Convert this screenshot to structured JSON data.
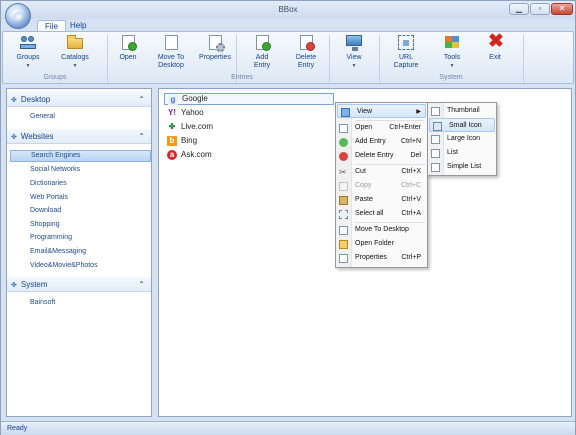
{
  "window": {
    "title": "BBox"
  },
  "tabs": [
    "File",
    "Help"
  ],
  "ribbon": {
    "groups_group": {
      "label": "Groups",
      "buttons": [
        {
          "label": "Groups"
        },
        {
          "label": "Catalogs"
        }
      ]
    },
    "entries_group": {
      "label": "Entries",
      "buttons": [
        {
          "label": "Open"
        },
        {
          "label": "Move To",
          "label2": "Desktop"
        },
        {
          "label": "Properties"
        },
        {
          "label": "Add",
          "label2": "Entry"
        },
        {
          "label": "Delete",
          "label2": "Entry"
        },
        {
          "label": "View"
        }
      ]
    },
    "system_group": {
      "label": "System",
      "buttons": [
        {
          "label": "URL",
          "label2": "Capture"
        },
        {
          "label": "Tools"
        },
        {
          "label": "Exit"
        }
      ]
    }
  },
  "sidebar": {
    "sections": [
      {
        "title": "Desktop",
        "items": [
          "General"
        ]
      },
      {
        "title": "Websites",
        "items": [
          "Search Engines",
          "Social Networks",
          "Dictionaries",
          "Web Portals",
          "Download",
          "Shopping",
          "Programming",
          "Email&Messaging",
          "Video&Movie&Photos"
        ]
      },
      {
        "title": "System",
        "items": [
          "Bainsoft"
        ]
      }
    ],
    "selected": "Search Engines"
  },
  "entries": [
    {
      "label": "Google",
      "icon": "google-icon",
      "color": "#3f6fd8"
    },
    {
      "label": "Yahoo",
      "icon": "yahoo-icon",
      "color": "#7b1fa2"
    },
    {
      "label": "Live.com",
      "icon": "windows-live-icon",
      "color": "#2b8a3e"
    },
    {
      "label": "Bing",
      "icon": "bing-icon",
      "color": "#f39c12"
    },
    {
      "label": "Ask.com",
      "icon": "ask-icon",
      "color": "#d62828"
    }
  ],
  "context_menu": {
    "items": [
      {
        "label": "View",
        "shortcut": "",
        "submenu": true
      },
      {
        "label": "Open",
        "shortcut": "Ctrl+Enter"
      },
      {
        "label": "Add Entry",
        "shortcut": "Ctrl+N"
      },
      {
        "label": "Delete Entry",
        "shortcut": "Del"
      },
      {
        "label": "Cut",
        "shortcut": "Ctrl+X"
      },
      {
        "label": "Copy",
        "shortcut": "Ctrl+C",
        "disabled": true
      },
      {
        "label": "Paste",
        "shortcut": "Ctrl+V"
      },
      {
        "label": "Select all",
        "shortcut": "Ctrl+A"
      },
      {
        "label": "Move To Desktop",
        "shortcut": ""
      },
      {
        "label": "Open Folder",
        "shortcut": ""
      },
      {
        "label": "Properties",
        "shortcut": "Ctrl+P"
      }
    ]
  },
  "view_submenu": {
    "items": [
      "Thumbnail",
      "Small Icon",
      "Large Icon",
      "List",
      "Simple List"
    ],
    "highlighted": "Small Icon"
  },
  "status": {
    "text": "Ready"
  },
  "colors": {
    "accent": "#15428b",
    "selection": "#c6dcf6",
    "exit": "#d2261c"
  }
}
